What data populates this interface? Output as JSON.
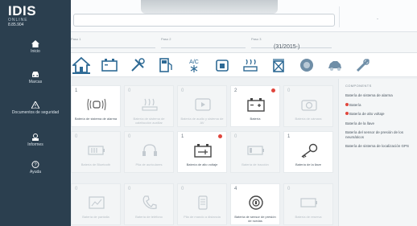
{
  "brand": {
    "name": "IDIS",
    "sub": "ONLINE",
    "version": "8.85.904"
  },
  "sidebar": {
    "items": [
      {
        "label": "Inicio",
        "icon": "home-icon"
      },
      {
        "label": "Marcas",
        "icon": "car-icon"
      },
      {
        "label": "Documentos de seguridad",
        "icon": "warning-icon"
      },
      {
        "label": "Informes",
        "icon": "report-icon"
      },
      {
        "label": "Ayuda",
        "icon": "help-icon"
      }
    ]
  },
  "topbar": {
    "search_value": "",
    "right_text": "-"
  },
  "filters": [
    {
      "label": "Paso 1",
      "value": ""
    },
    {
      "label": "Paso 2",
      "value": ""
    },
    {
      "label": "Paso 3",
      "value": "(31/2015-)"
    }
  ],
  "categories": [
    "home-icon",
    "battery-icon",
    "tools-icon",
    "fuel-pump-icon",
    "ac-icon",
    "engine-icon",
    "heater-icon",
    "recycle-icon",
    "wheel-icon",
    "car-body-icon",
    "extra-icon"
  ],
  "tiles": [
    {
      "num": "1",
      "label": "Batería de sistema de alarma",
      "icon": "alarm-icon",
      "dim": false,
      "badge": false
    },
    {
      "num": "0",
      "label": "Batería de sistema de calefacción auxiliar",
      "icon": "heater-icon",
      "dim": true,
      "badge": false
    },
    {
      "num": "0",
      "label": "Batería de audio y sistema de AV",
      "icon": "media-icon",
      "dim": true,
      "badge": false
    },
    {
      "num": "2",
      "label": "Batería",
      "icon": "battery-icon",
      "dim": false,
      "badge": true
    },
    {
      "num": "0",
      "label": "Batería de cámara",
      "icon": "camera-icon",
      "dim": true,
      "badge": false
    },
    {
      "num": "0",
      "label": "Batería de Bluetooth",
      "icon": "bluetooth-battery-icon",
      "dim": true,
      "badge": false
    },
    {
      "num": "0",
      "label": "Pila de auriculares",
      "icon": "headphones-icon",
      "dim": true,
      "badge": false
    },
    {
      "num": "1",
      "label": "Batería de alto voltaje",
      "icon": "hv-battery-icon",
      "dim": false,
      "badge": true
    },
    {
      "num": "0",
      "label": "Batería de tracción",
      "icon": "battery-low-icon",
      "dim": true,
      "badge": false
    },
    {
      "num": "1",
      "label": "Batería de la llave",
      "icon": "key-icon",
      "dim": false,
      "badge": false
    },
    {
      "num": "0",
      "label": "Batería de pantalla",
      "icon": "screen-icon",
      "dim": true,
      "badge": false
    },
    {
      "num": "0",
      "label": "Batería de teléfono",
      "icon": "phone-icon",
      "dim": true,
      "badge": false
    },
    {
      "num": "0",
      "label": "Pila de mando a distancia",
      "icon": "remote-icon",
      "dim": true,
      "badge": false
    },
    {
      "num": "4",
      "label": "Batería de sensor de presión de ruedas",
      "icon": "tpms-icon",
      "dim": false,
      "badge": false
    },
    {
      "num": "0",
      "label": "Batería de reserva",
      "icon": "battery-spare-icon",
      "dim": true,
      "badge": false
    }
  ],
  "panel": {
    "title": "COMPONENTS",
    "items": [
      {
        "label": "Batería de sistema de alarma",
        "dot": false
      },
      {
        "label": "Batería",
        "dot": true
      },
      {
        "label": "Batería de alto voltaje",
        "dot": true
      },
      {
        "label": "Batería de la llave",
        "dot": false
      },
      {
        "label": "Batería del sensor de presión de los neumáticos",
        "dot": false
      },
      {
        "label": "Batería de sistema de localización GPS",
        "dot": false
      }
    ]
  },
  "colors": {
    "sidebar": "#2b3f4f",
    "accent": "#2e6a95",
    "alert": "#e0463d"
  }
}
